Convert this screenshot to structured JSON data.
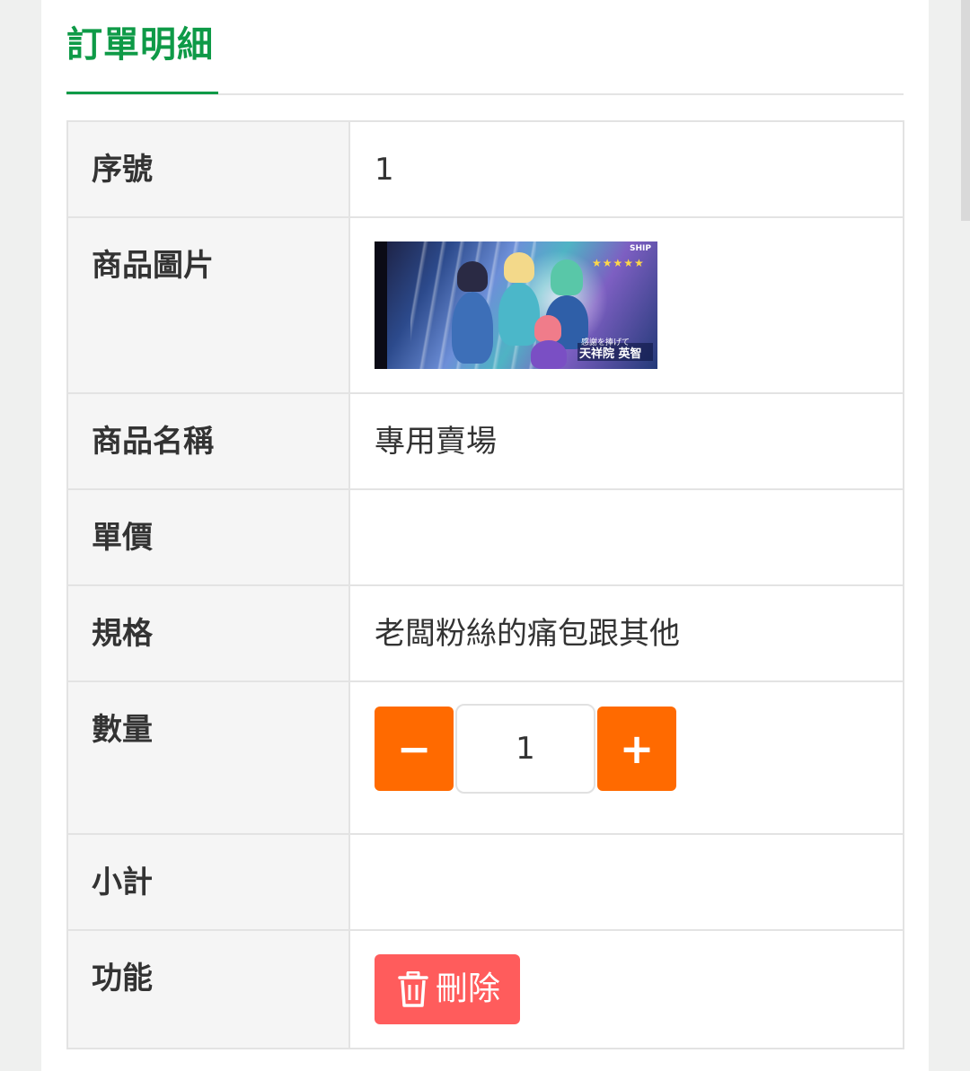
{
  "page": {
    "title": "訂單明細"
  },
  "order_detail": {
    "rows": [
      {
        "label": "序號",
        "value": "1"
      },
      {
        "label": "商品圖片",
        "value": ""
      },
      {
        "label": "商品名稱",
        "value": "專用賣場"
      },
      {
        "label": "單價",
        "value": ""
      },
      {
        "label": "規格",
        "value": "老闆粉絲的痛包跟其他"
      },
      {
        "label": "數量",
        "value": ""
      },
      {
        "label": "小計",
        "value": ""
      },
      {
        "label": "功能",
        "value": ""
      }
    ],
    "image_text": {
      "badge": "SHIP",
      "stars": "★★★★★",
      "caption_line1": "感謝を捧げて",
      "caption_line2": "天祥院 英智"
    },
    "quantity": {
      "decrement_label": "−",
      "increment_label": "+",
      "value": "1"
    },
    "delete_label": "刪除"
  },
  "colors": {
    "accent_green": "#0e9a47",
    "stepper_orange": "#ff6a00",
    "delete_red": "#ff5c5c"
  }
}
